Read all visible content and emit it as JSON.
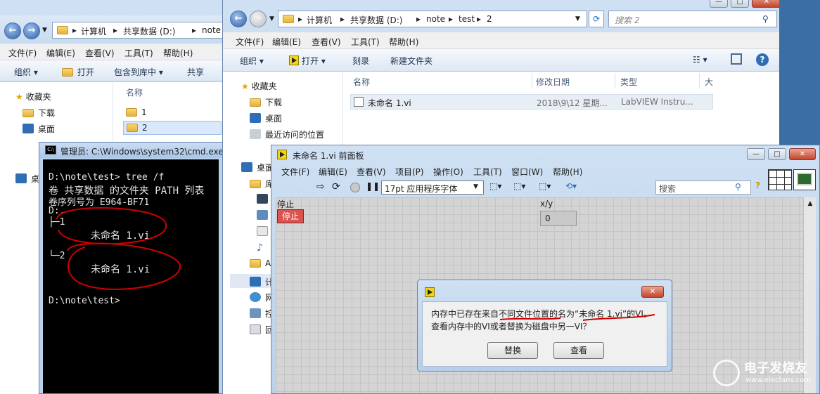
{
  "explorer_left": {
    "breadcrumb": [
      "计算机",
      "共享数据 (D:)",
      "note"
    ],
    "menu": [
      "文件(F)",
      "编辑(E)",
      "查看(V)",
      "工具(T)",
      "帮助(H)"
    ],
    "toolbar": [
      "组织 ▾",
      "打开",
      "包含到库中 ▾",
      "共享"
    ],
    "nav": {
      "favorites": "收藏夹",
      "downloads": "下载",
      "desktop": "桌面",
      "desktop2": "桌"
    },
    "column_name": "名称",
    "files": [
      "1",
      "2"
    ]
  },
  "explorer_right": {
    "breadcrumb": [
      "计算机",
      "共享数据 (D:)",
      "note",
      "test",
      "2"
    ],
    "search_placeholder": "搜索 2",
    "menu": [
      "文件(F)",
      "编辑(E)",
      "查看(V)",
      "工具(T)",
      "帮助(H)"
    ],
    "toolbar": {
      "organize": "组织 ▾",
      "open": "打开 ▾",
      "burn": "刻录",
      "new_folder": "新建文件夹"
    },
    "nav": {
      "favorites": "收藏夹",
      "downloads": "下载",
      "desktop": "桌面",
      "recent": "最近访问的位置",
      "desktop2": "桌面",
      "lib": "库",
      "a": "A",
      "computer": "计",
      "network": "网",
      "control": "控",
      "recycle": "回"
    },
    "columns": {
      "name": "名称",
      "date": "修改日期",
      "type": "类型",
      "size": "大"
    },
    "row": {
      "name": "未命名 1.vi",
      "date": "2018\\9\\12 星期...",
      "type": "LabVIEW Instru..."
    }
  },
  "cmd": {
    "title": "管理员: C:\\Windows\\system32\\cmd.exe",
    "lines": [
      "D:\\note\\test> tree /f",
      "卷 共享数据 的文件夹 PATH 列表",
      "卷序列号为 E964-BF71",
      "D:.",
      "├─1",
      "未命名 1.vi",
      "└─2",
      "未命名 1.vi",
      "D:\\note\\test>"
    ]
  },
  "labview": {
    "title": "未命名 1.vi 前面板",
    "menu": [
      "文件(F)",
      "编辑(E)",
      "查看(V)",
      "项目(P)",
      "操作(O)",
      "工具(T)",
      "窗口(W)",
      "帮助(H)"
    ],
    "font_select": "17pt 应用程序字体",
    "search_placeholder": "搜索",
    "stop_label": "停止",
    "stop_button": "停止",
    "xy_label": "x/y",
    "xy_value": "0"
  },
  "dialog": {
    "message_line1": "内存中已存在来自不同文件位置的名为“未命名 1.vi”的VI。",
    "message_line2": "查看内存中的VI或者替换为磁盘中另一VI？",
    "replace_button": "替换",
    "view_button": "查看"
  },
  "watermark": {
    "text_cn": "电子发烧友",
    "text_en": "www.elecfans.com"
  },
  "colors": {
    "annotation": "#d10000",
    "desktop": "#3b6ea5",
    "lv_stop": "#d9534f"
  }
}
